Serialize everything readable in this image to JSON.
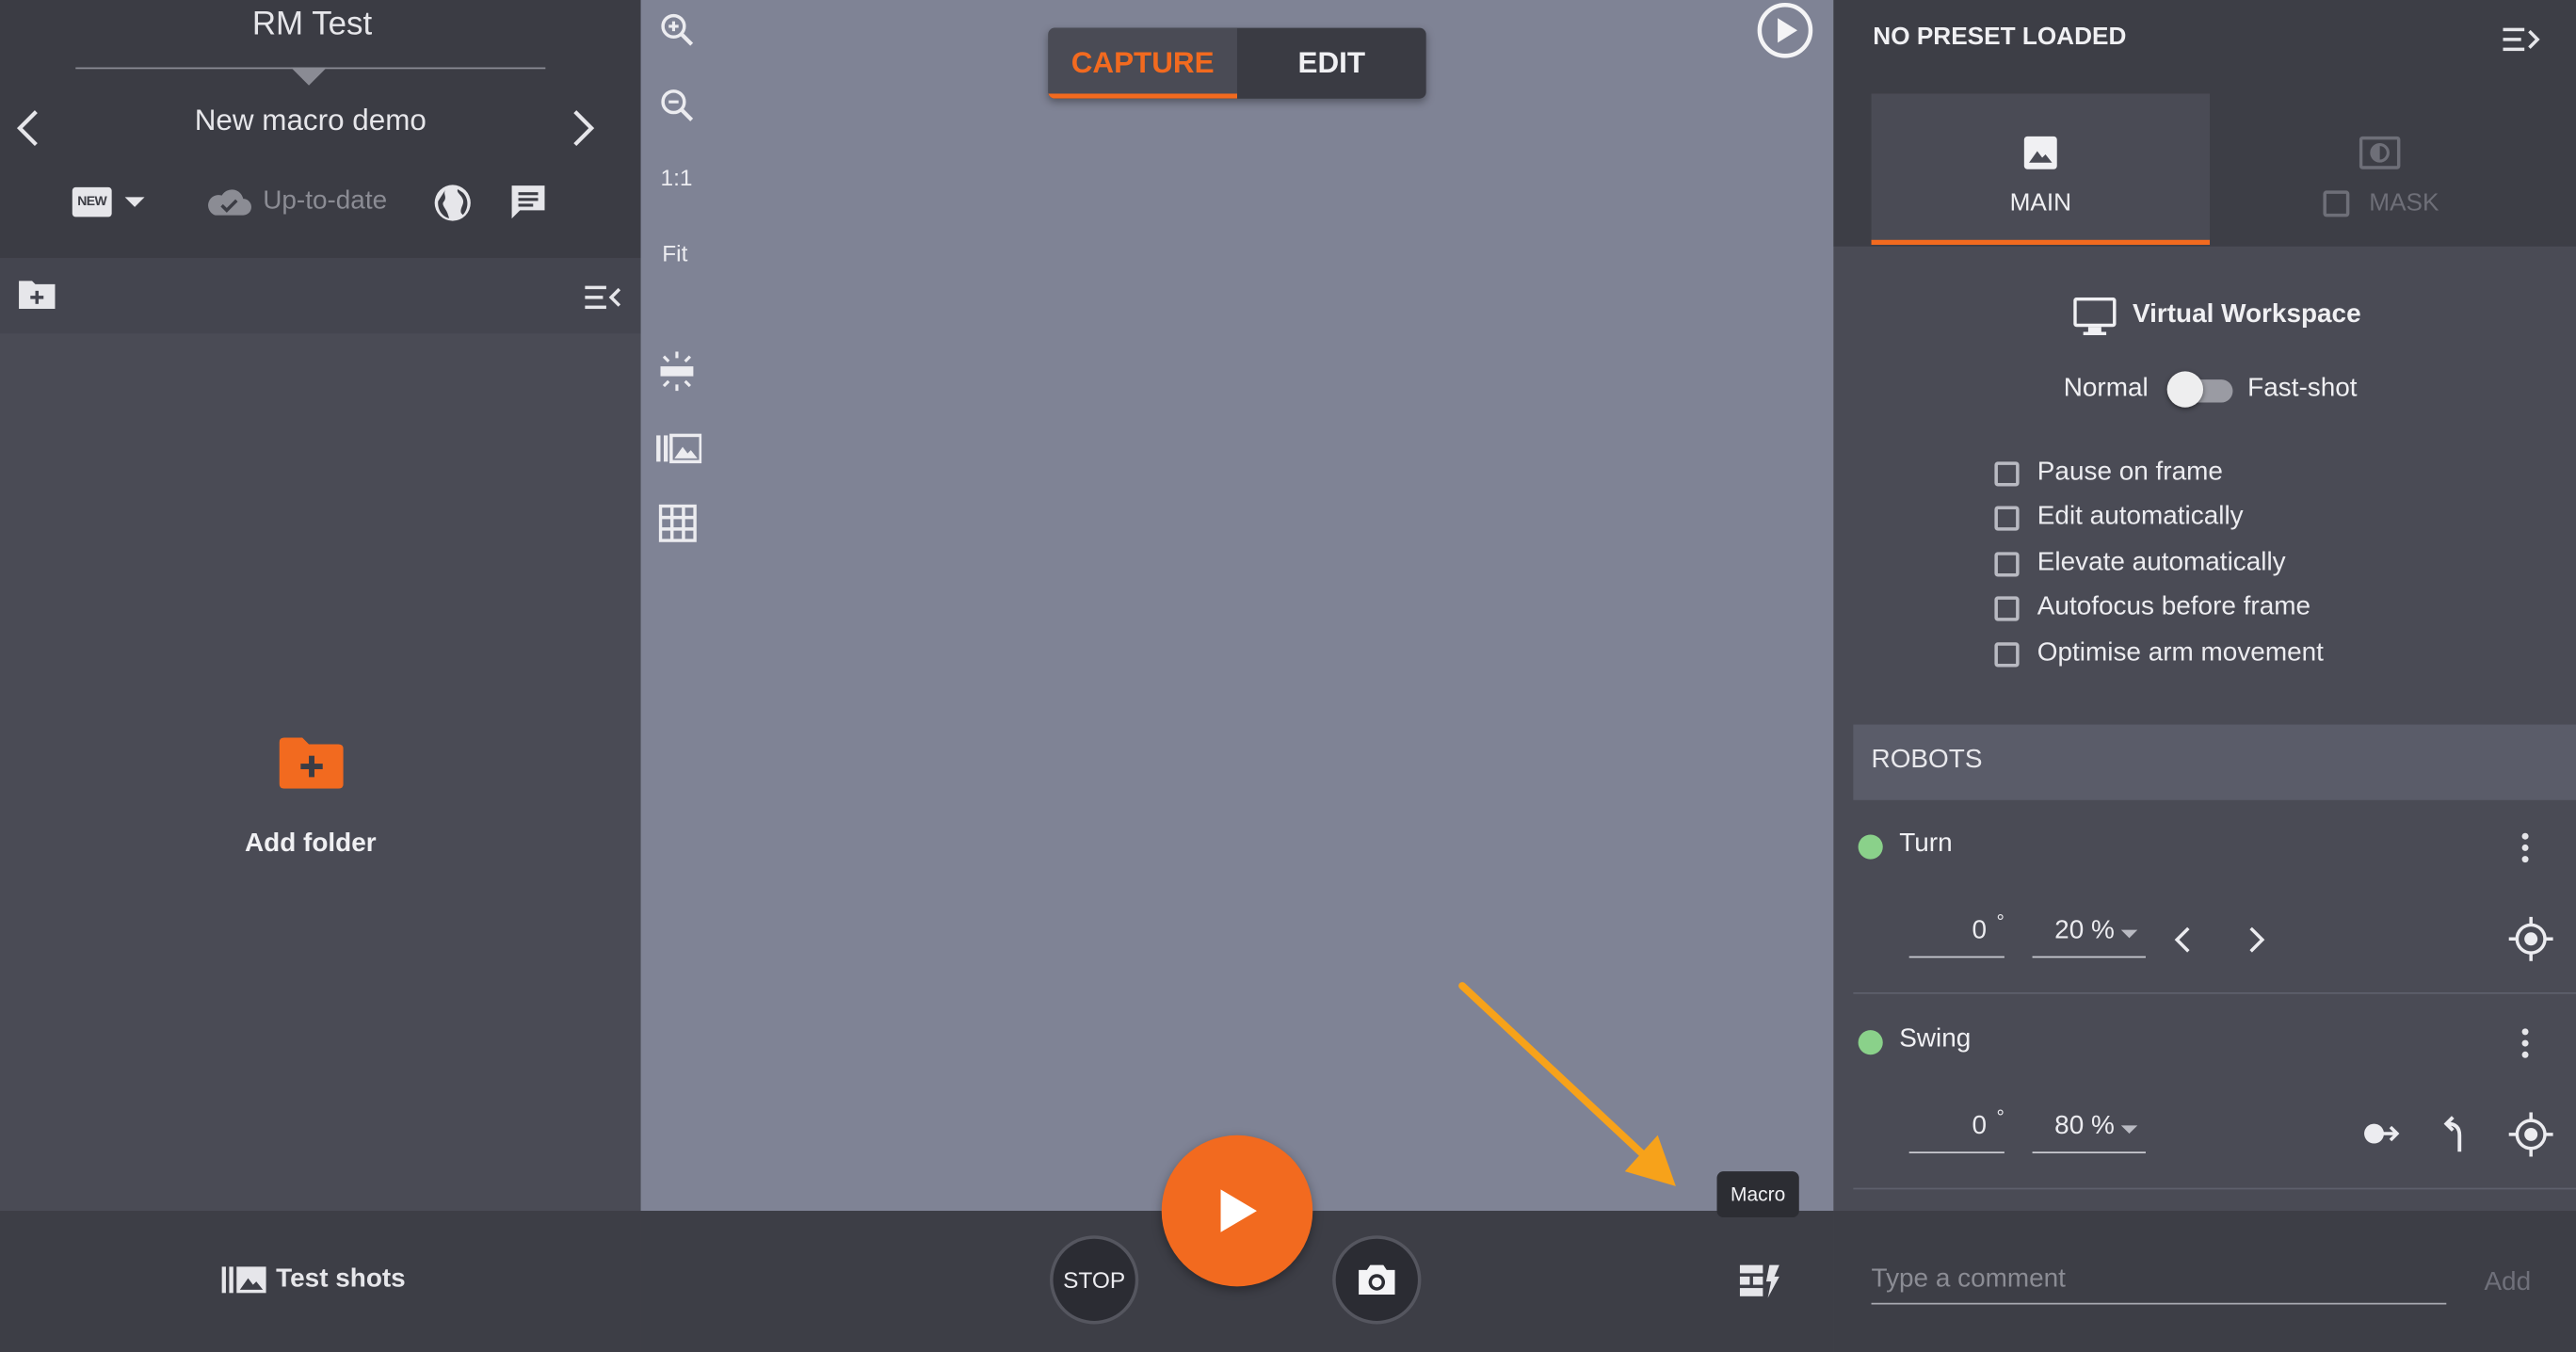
{
  "colors": {
    "accent": "#f26a1f",
    "canvas": "#7f8395",
    "robot_status": "#8ad18a"
  },
  "left_panel": {
    "project_title": "RM Test",
    "macro_name": "New macro demo",
    "badge_text": "NEW",
    "sync_status": "Up-to-date",
    "add_folder_label": "Add folder",
    "test_shots_label": "Test shots"
  },
  "canvas": {
    "zoom_actual": "1:1",
    "zoom_fit": "Fit",
    "mode_tabs": {
      "capture": "CAPTURE",
      "edit": "EDIT",
      "active": "CAPTURE"
    }
  },
  "bottom_bar": {
    "stop_label": "STOP",
    "macro_tooltip": "Macro"
  },
  "right_panel": {
    "preset_title": "NO PRESET LOADED",
    "tabs": [
      {
        "label": "MAIN",
        "icon": "image-icon",
        "active": true
      },
      {
        "label": "MASK",
        "icon": "mask-icon",
        "active": false
      }
    ],
    "workspace_title": "Virtual Workspace",
    "mode_left": "Normal",
    "mode_right": "Fast-shot",
    "options": [
      {
        "label": "Pause on frame",
        "checked": false
      },
      {
        "label": "Edit automatically",
        "checked": false
      },
      {
        "label": "Elevate automatically",
        "checked": false
      },
      {
        "label": "Autofocus before frame",
        "checked": false
      },
      {
        "label": "Optimise arm movement",
        "checked": false
      }
    ],
    "robots_title": "ROBOTS",
    "robots": [
      {
        "name": "Turn",
        "angle": "0",
        "angle_unit": "°",
        "speed": "20 %"
      },
      {
        "name": "Swing",
        "angle": "0",
        "angle_unit": "°",
        "speed": "80 %"
      }
    ],
    "comment_placeholder": "Type a comment",
    "add_label": "Add"
  }
}
